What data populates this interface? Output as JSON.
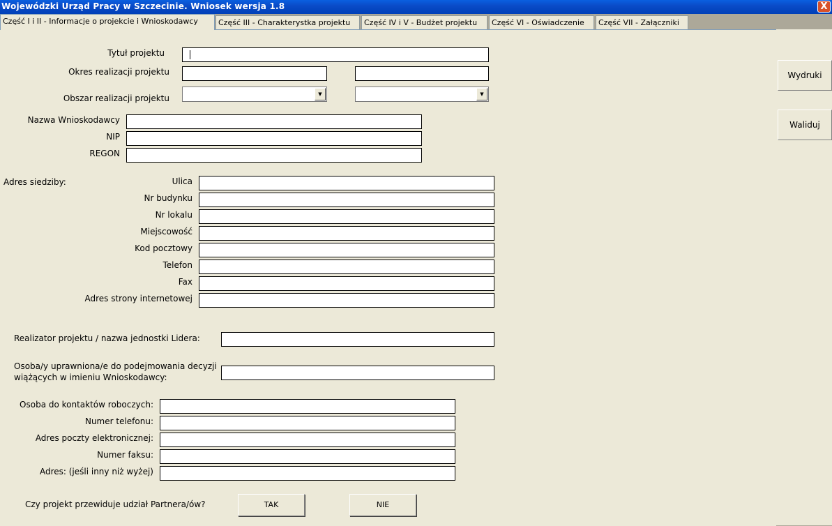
{
  "window": {
    "title": "Wojewódzki Urząd Pracy w Szczecinie. Wniosek wersja 1.8",
    "close_label": "X"
  },
  "tabs": [
    {
      "label": "Część I i II - Informacje o projekcie i Wnioskodawcy",
      "active": true
    },
    {
      "label": "Część III - Charakterystka projektu"
    },
    {
      "label": "Część IV i V - Budżet projektu"
    },
    {
      "label": "Część VI - Oświadczenie"
    },
    {
      "label": "Część VII - Załączniki"
    }
  ],
  "side": {
    "print_label": "Wydruki",
    "validate_label": "Waliduj"
  },
  "project": {
    "title_label": "Tytuł projektu",
    "period_label": "Okres realizacji projektu",
    "area_label": "Obszar realizacji projektu",
    "dropdown_icon": "triangle-down"
  },
  "applicant": {
    "name_label": "Nazwa Wnioskodawcy",
    "nip_label": "NIP",
    "regon_label": "REGON"
  },
  "address": {
    "heading": "Adres siedziby:",
    "street_label": "Ulica",
    "building_label": "Nr budynku",
    "unit_label": "Nr lokalu",
    "city_label": "Miejscowość",
    "postal_label": "Kod pocztowy",
    "phone_label": "Telefon",
    "fax_label": "Fax",
    "website_label": "Adres strony internetowej"
  },
  "realizer": {
    "label": "Realizator projektu / nazwa jednostki Lidera:"
  },
  "authorized": {
    "label_line1": "Osoba/y uprawniona/e do podejmowania decyzji",
    "label_line2": "wiążących w imieniu Wnioskodawcy:"
  },
  "contact": {
    "person_label": "Osoba do kontaktów roboczych:",
    "phone_label": "Numer telefonu:",
    "email_label": "Adres poczty elektronicznej:",
    "fax_label": "Numer faksu:",
    "address_label": "Adres: (jeśli inny niż wyżej)"
  },
  "partners": {
    "question": "Czy projekt przewiduje udział Partnera/ów?",
    "yes_label": "TAK",
    "no_label": "NIE"
  }
}
